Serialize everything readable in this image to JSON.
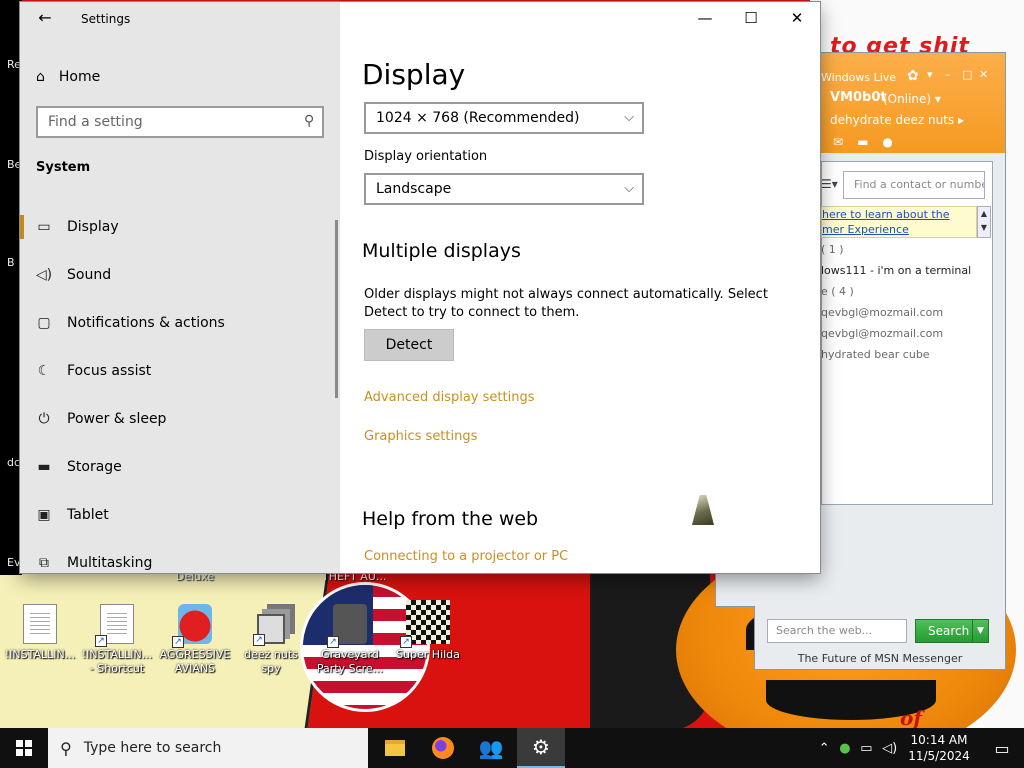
{
  "desktop": {
    "left_strip": [
      "Re",
      "Be",
      "B",
      "dc",
      "Ev"
    ],
    "scribble": "to get shit",
    "overtext_deluxe": "Deluxe",
    "overtext_theft": "THEFT AU...",
    "overtext_right": "of",
    "icons": [
      {
        "label": "!INSTALLIN...",
        "icon": "text-document-icon"
      },
      {
        "label": "!INSTALLIN...\n- Shortcut",
        "icon": "text-document-shortcut-icon"
      },
      {
        "label": "AGGRESSIVE\nAVIANS",
        "icon": "angry-bird-icon"
      },
      {
        "label": "deez nuts spy",
        "icon": "cascade-windows-icon"
      },
      {
        "label": "Graveyard\nParty Scre...",
        "icon": "graveyard-icon"
      },
      {
        "label": "Super Hilda",
        "icon": "pixel-character-icon"
      }
    ]
  },
  "settings": {
    "window_title": "Settings",
    "controls": {
      "minimize": "—",
      "maximize": "☐",
      "close": "✕"
    },
    "home_label": "Home",
    "search_placeholder": "Find a setting",
    "section": "System",
    "nav_items": [
      {
        "label": "Display",
        "icon": "monitor-icon"
      },
      {
        "label": "Sound",
        "icon": "speaker-icon"
      },
      {
        "label": "Notifications & actions",
        "icon": "notification-icon"
      },
      {
        "label": "Focus assist",
        "icon": "moon-icon"
      },
      {
        "label": "Power & sleep",
        "icon": "power-icon"
      },
      {
        "label": "Storage",
        "icon": "storage-icon"
      },
      {
        "label": "Tablet",
        "icon": "tablet-icon"
      },
      {
        "label": "Multitasking",
        "icon": "multitasking-icon"
      }
    ],
    "active_nav": "Display",
    "page_title": "Display",
    "resolution_value": "1024 × 768 (Recommended)",
    "orientation_label": "Display orientation",
    "orientation_value": "Landscape",
    "multiple_displays_title": "Multiple displays",
    "multiple_displays_text": "Older displays might not always connect automatically. Select Detect to try to connect to them.",
    "detect_label": "Detect",
    "advanced_link": "Advanced display settings",
    "graphics_link": "Graphics settings",
    "help_title": "Help from the web",
    "help_link": "Connecting to a projector or PC",
    "accent_color": "#c8901f"
  },
  "msn": {
    "app_title": "Windows Live",
    "username": "VM0b0t",
    "status": "(Online) ▾",
    "personal_message": "dehydrate deez nuts ▸",
    "find_placeholder": "Find a contact or number",
    "banner_line1": "here to learn about the",
    "banner_line2": "mer Experience",
    "rows": [
      {
        "text": "( 1 )",
        "gray": true
      },
      {
        "text": "lows111 - i'm on a terminal",
        "gray": false
      },
      {
        "text": "e ( 4 )",
        "gray": true
      },
      {
        "text": "qevbgl@mozmail.com",
        "gray": true
      },
      {
        "text": "qevbgl@mozmail.com",
        "gray": true
      },
      {
        "text": "hydrated bear cube",
        "gray": true
      }
    ],
    "web_search_placeholder": "Search the web...",
    "search_button": "Search",
    "footer": "The Future of MSN Messenger",
    "brand_color": "#f59a22"
  },
  "taskbar": {
    "search_placeholder": "Type here to search",
    "apps": [
      {
        "name": "file-explorer",
        "active": false
      },
      {
        "name": "firefox",
        "active": false
      },
      {
        "name": "msn-messenger",
        "active": false
      },
      {
        "name": "settings",
        "active": true
      }
    ],
    "time": "10:14 AM",
    "date": "11/5/2024"
  }
}
